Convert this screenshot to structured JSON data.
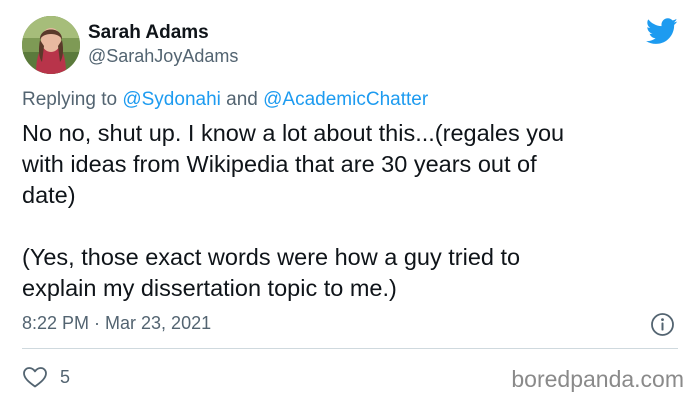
{
  "author": {
    "display_name": "Sarah Adams",
    "handle": "@SarahJoyAdams",
    "avatar_icon": "profile-photo"
  },
  "reply": {
    "prefix": "Replying to ",
    "mention_1": "@Sydonahi",
    "conjunction": " and ",
    "mention_2": "@AcademicChatter"
  },
  "tweet": {
    "lines": [
      "No no, shut up. I know a lot about this...(regales you",
      "with ideas from Wikipedia that are 30 years out of",
      "date)",
      "(Yes, those exact words were how a guy tried to",
      "explain my dissertation topic to me.)"
    ],
    "timestamp": "8:22 PM · Mar 23, 2021"
  },
  "actions": {
    "like_count": "5",
    "like_icon": "heart-icon",
    "info_icon": "info-icon"
  },
  "branding": {
    "platform_icon": "twitter-bird-icon",
    "watermark": "boredpanda.com"
  },
  "colors": {
    "accent": "#1d9bf0",
    "text": "#0f1419",
    "secondary": "#536471",
    "divider": "#cfd9de"
  }
}
